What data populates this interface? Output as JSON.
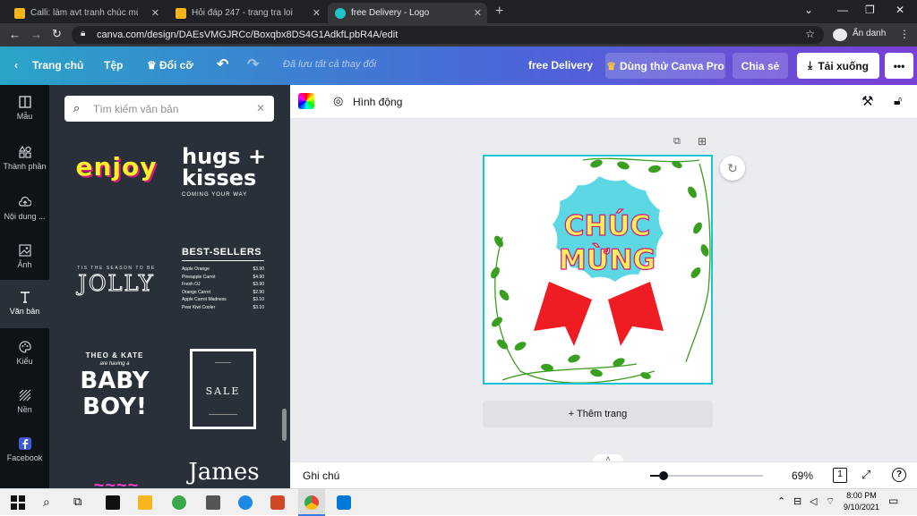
{
  "browser": {
    "tabs": [
      {
        "title": "Calli: làm avt tranh chúc mừng N",
        "icon": "hoidap-icon",
        "active": false
      },
      {
        "title": "Hỏi đáp 247 - trang tra loi",
        "icon": "hoidap-icon",
        "active": false
      },
      {
        "title": "free Delivery - Logo",
        "icon": "canva-icon",
        "active": true
      }
    ],
    "url": "canva.com/design/DAEsVMGJRCc/Boxqbx8DS4G1AdkfLpbR4A/edit",
    "incognito_label": "Ẩn danh"
  },
  "header": {
    "home": "Trang chủ",
    "file": "Tệp",
    "resize": "Đổi cỡ",
    "saved": "Đã lưu tất cả thay đổi",
    "design_title": "free Delivery",
    "try_pro": "Dùng thử Canva Pro",
    "share": "Chia sẻ",
    "download": "Tải xuống",
    "more": "•••"
  },
  "rail": [
    {
      "label": "Mẫu",
      "icon": "template-icon"
    },
    {
      "label": "Thành phần",
      "icon": "elements-icon"
    },
    {
      "label": "Nội dung ...",
      "icon": "upload-icon"
    },
    {
      "label": "Ảnh",
      "icon": "photo-icon"
    },
    {
      "label": "Văn bản",
      "icon": "text-icon",
      "active": true
    },
    {
      "label": "Kiểu",
      "icon": "palette-icon"
    },
    {
      "label": "Nền",
      "icon": "background-icon"
    },
    {
      "label": "Facebook",
      "icon": "facebook-icon"
    }
  ],
  "panel": {
    "search_placeholder": "Tìm kiếm văn bản",
    "enjoy": "enjoy",
    "hugs_line1": "hugs +",
    "hugs_line2": "kisses",
    "hugs_sub": "COMING YOUR WAY",
    "jolly_top": "TIS THE SEASON TO BE",
    "jolly": "JOLLY",
    "bestsellers_title": "BEST-SELLERS",
    "bestsellers": [
      {
        "item": "Apple Orange",
        "price": "$3.90"
      },
      {
        "item": "Pineapple Carrot",
        "price": "$4.90"
      },
      {
        "item": "Fresh OJ",
        "price": "$3.90"
      },
      {
        "item": "Orange Carrot",
        "price": "$2.90"
      },
      {
        "item": "Apple Carrot Madness",
        "price": "$3.10"
      },
      {
        "item": "Pear Kiwi Cooler",
        "price": "$3.10"
      }
    ],
    "baby_top": "THEO & KATE",
    "baby_sub": "are having a",
    "baby_line1": "BABY",
    "baby_line2": "BOY!",
    "sale": "SALE",
    "james": "James"
  },
  "editor": {
    "animate": "Hình động",
    "design_text_line1": "CHÚC",
    "design_text_line2": "MỪNG",
    "add_page": "+ Thêm trang",
    "notes": "Ghi chú",
    "zoom": "69%",
    "page_count": "1",
    "help": "?"
  },
  "taskbar": {
    "time": "8:00 PM",
    "date": "9/10/2021"
  },
  "colors": {
    "badge": "#5cd8e5",
    "ribbon": "#ef1c24",
    "text_fill": "#f9ef5c",
    "leaf": "#3a9e1e",
    "selection": "#1bc3d8"
  }
}
